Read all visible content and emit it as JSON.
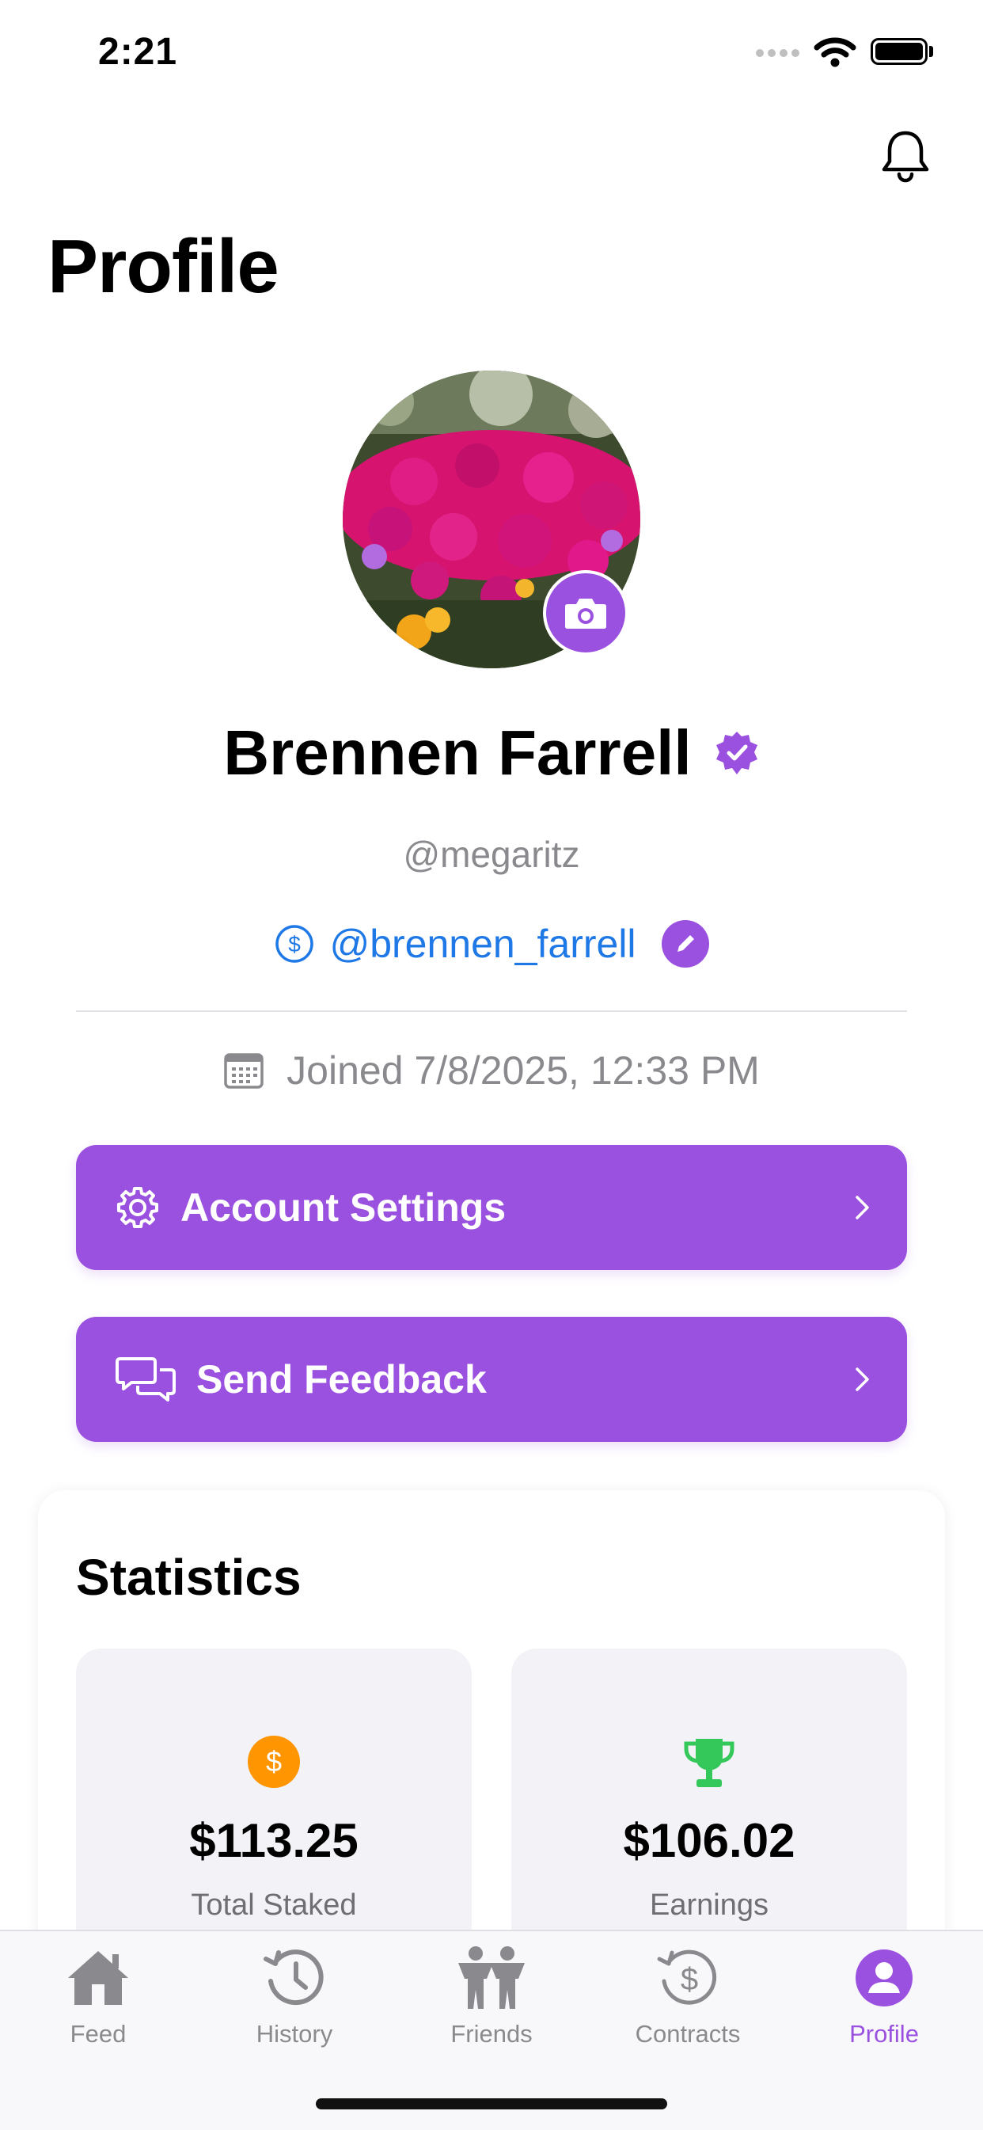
{
  "status_bar": {
    "time": "2:21"
  },
  "header": {
    "title": "Profile"
  },
  "profile": {
    "name": "Brennen Farrell",
    "username": "@megaritz",
    "cashtag": "@brennen_farrell",
    "joined": "Joined 7/8/2025, 12:33 PM"
  },
  "actions": {
    "settings_label": "Account Settings",
    "feedback_label": "Send Feedback"
  },
  "statistics": {
    "title": "Statistics",
    "items": [
      {
        "value": "$113.25",
        "label": "Total Staked",
        "icon": "dollar-coin-icon"
      },
      {
        "value": "$106.02",
        "label": "Earnings",
        "icon": "trophy-icon"
      }
    ]
  },
  "tabs": [
    {
      "label": "Feed",
      "icon": "house-icon"
    },
    {
      "label": "History",
      "icon": "history-clock-icon"
    },
    {
      "label": "Friends",
      "icon": "people-icon"
    },
    {
      "label": "Contracts",
      "icon": "dollar-cycle-icon"
    },
    {
      "label": "Profile",
      "icon": "person-circle-icon",
      "active": true
    }
  ],
  "colors": {
    "accent": "#9b51e0",
    "link": "#1e78e6",
    "secondary_text": "#8a8a8e",
    "coin": "#ff9500",
    "trophy": "#34c759"
  }
}
